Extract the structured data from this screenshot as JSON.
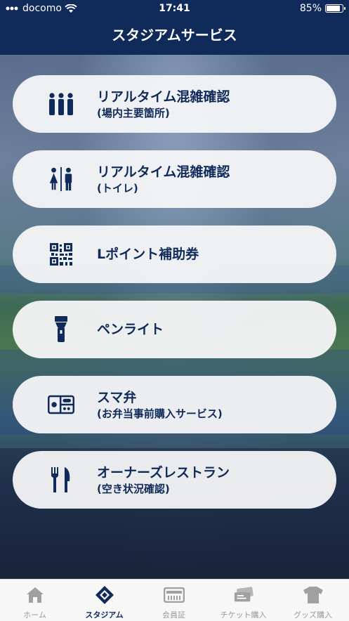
{
  "status_bar": {
    "carrier": "docomo",
    "time": "17:41",
    "battery": "85%",
    "battery_level": 0.85
  },
  "header": {
    "title": "スタジアムサービス"
  },
  "menu": [
    {
      "title": "リアルタイム混雑確認",
      "sub": "(場内主要箇所)",
      "icon": "people-icon"
    },
    {
      "title": "リアルタイム混雑確認",
      "sub": "(トイレ)",
      "icon": "restroom-icon"
    },
    {
      "title": "Lポイント補助券",
      "sub": "",
      "icon": "qr-code-icon"
    },
    {
      "title": "ペンライト",
      "sub": "",
      "icon": "penlight-icon"
    },
    {
      "title": "スマ弁",
      "sub": "(お弁当事前購入サービス)",
      "icon": "bento-icon"
    },
    {
      "title": "オーナーズレストラン",
      "sub": "(空き状況確認)",
      "icon": "fork-knife-icon"
    }
  ],
  "tabbar": {
    "items": [
      {
        "label": "ホーム",
        "icon": "home-icon"
      },
      {
        "label": "スタジアム",
        "icon": "stadium-icon"
      },
      {
        "label": "会員証",
        "icon": "member-card-icon"
      },
      {
        "label": "チケット購入",
        "icon": "ticket-icon"
      },
      {
        "label": "グッズ購入",
        "icon": "tshirt-icon"
      }
    ],
    "active": "スタジアム"
  },
  "colors": {
    "primary": "#102a5a",
    "button_bg": "#f6f6f8",
    "tab_inactive": "#9a9a9a"
  }
}
